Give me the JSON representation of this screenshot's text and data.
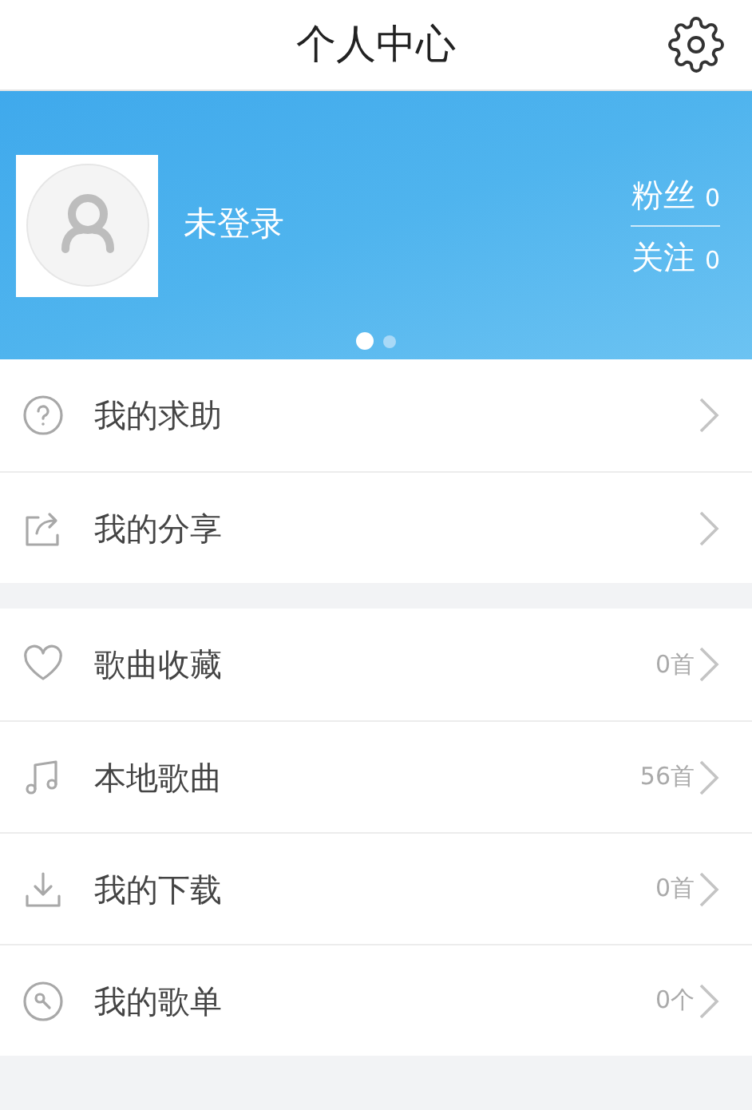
{
  "header": {
    "title": "个人中心"
  },
  "profile": {
    "name": "未登录",
    "stats": [
      {
        "label": "粉丝",
        "value": "0"
      },
      {
        "label": "关注",
        "value": "0"
      }
    ],
    "dots": [
      {
        "selected": true
      },
      {
        "selected": false
      }
    ]
  },
  "groups": [
    {
      "items": [
        {
          "kind": "help",
          "label": "我的求助"
        },
        {
          "kind": "share",
          "label": "我的分享"
        }
      ]
    },
    {
      "items": [
        {
          "kind": "favorite",
          "label": "歌曲收藏",
          "count": "0首"
        },
        {
          "kind": "music",
          "label": "本地歌曲",
          "count": "56首"
        },
        {
          "kind": "download",
          "label": "我的下载",
          "count": "0首"
        },
        {
          "kind": "playlist",
          "label": "我的歌单",
          "count": "0个"
        }
      ]
    }
  ]
}
